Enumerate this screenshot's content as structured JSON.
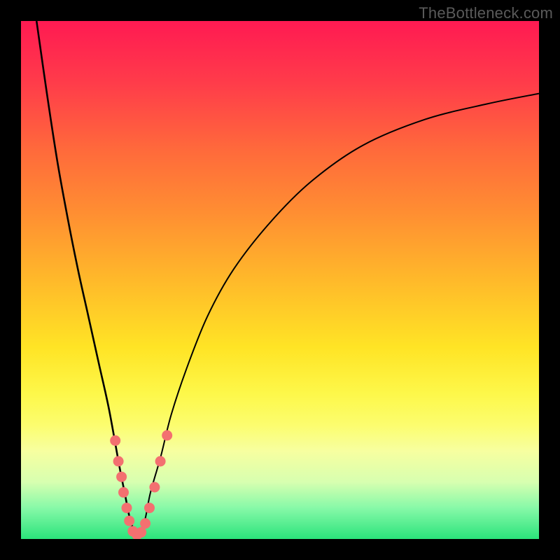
{
  "watermark": "TheBottleneck.com",
  "chart_data": {
    "type": "line",
    "title": "",
    "xlabel": "",
    "ylabel": "",
    "xlim": [
      0,
      100
    ],
    "ylim": [
      0,
      100
    ],
    "series": [
      {
        "name": "bottleneck-curve",
        "x": [
          3,
          5,
          7,
          9,
          11,
          13,
          15,
          17,
          19,
          20,
          21,
          22,
          23,
          24,
          25,
          27,
          29,
          32,
          36,
          41,
          48,
          56,
          66,
          78,
          90,
          100
        ],
        "y": [
          100,
          86,
          73,
          62,
          52,
          43,
          34,
          25,
          14,
          9,
          4,
          1,
          1,
          4,
          9,
          16,
          24,
          33,
          43,
          52,
          61,
          69,
          76,
          81,
          84,
          86
        ]
      }
    ],
    "dots": {
      "name": "highlight-points",
      "color": "#f37070",
      "points": [
        {
          "x": 18.2,
          "y": 19
        },
        {
          "x": 18.8,
          "y": 15
        },
        {
          "x": 19.4,
          "y": 12
        },
        {
          "x": 19.8,
          "y": 9
        },
        {
          "x": 20.4,
          "y": 6
        },
        {
          "x": 20.9,
          "y": 3.5
        },
        {
          "x": 21.6,
          "y": 1.5
        },
        {
          "x": 22.4,
          "y": 0.8
        },
        {
          "x": 23.2,
          "y": 1.3
        },
        {
          "x": 24.0,
          "y": 3
        },
        {
          "x": 24.8,
          "y": 6
        },
        {
          "x": 25.8,
          "y": 10
        },
        {
          "x": 26.9,
          "y": 15
        },
        {
          "x": 28.2,
          "y": 20
        }
      ]
    }
  }
}
